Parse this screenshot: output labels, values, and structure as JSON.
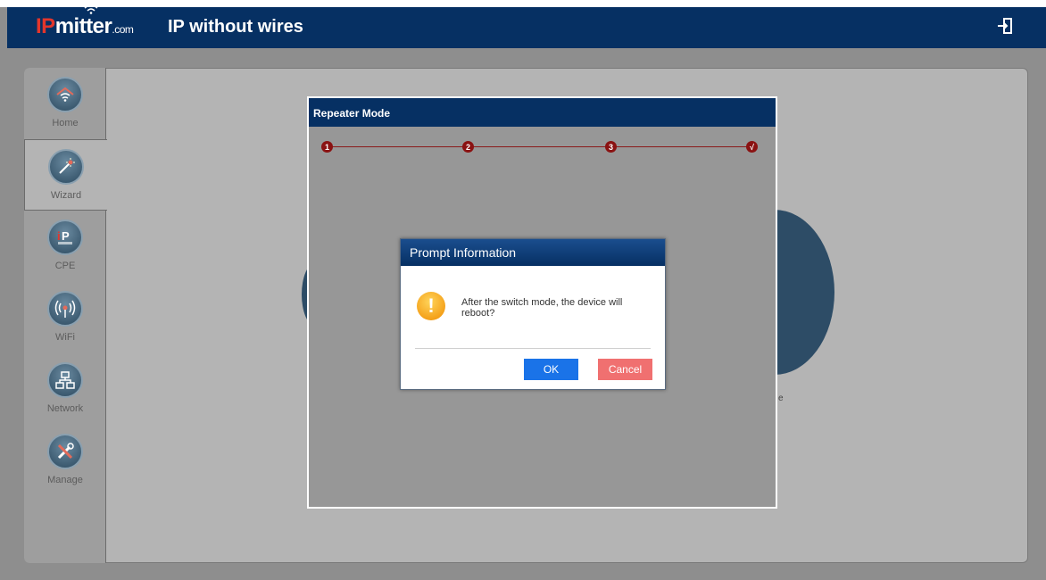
{
  "header": {
    "logo_ip": "IP",
    "logo_rest": "mitter",
    "logo_com": ".com",
    "slogan": "IP without wires",
    "logout_icon": "logout-icon"
  },
  "sidebar": {
    "items": [
      {
        "label": "Home",
        "icon": "home-wifi-icon",
        "active": false
      },
      {
        "label": "Wizard",
        "icon": "wizard-wand-icon",
        "active": true
      },
      {
        "label": "CPE",
        "icon": "ipmitter-cpe-icon",
        "active": false
      },
      {
        "label": "WiFi",
        "icon": "wifi-broadcast-icon",
        "active": false
      },
      {
        "label": "Network",
        "icon": "network-icon",
        "active": false
      },
      {
        "label": "Manage",
        "icon": "tools-icon",
        "active": false
      }
    ]
  },
  "wizard": {
    "title": "Repeater Mode",
    "steps": [
      "1",
      "2",
      "3",
      "√"
    ]
  },
  "background": {
    "partial_text": "e"
  },
  "prompt": {
    "title": "Prompt Information",
    "icon": "warning-icon",
    "message": "After the switch mode, the device will reboot?",
    "ok_label": "OK",
    "cancel_label": "Cancel"
  },
  "colors": {
    "header_bg": "#063063",
    "ok_button": "#1a73e8",
    "cancel_button": "#f07070",
    "step_color": "#8a1212"
  }
}
